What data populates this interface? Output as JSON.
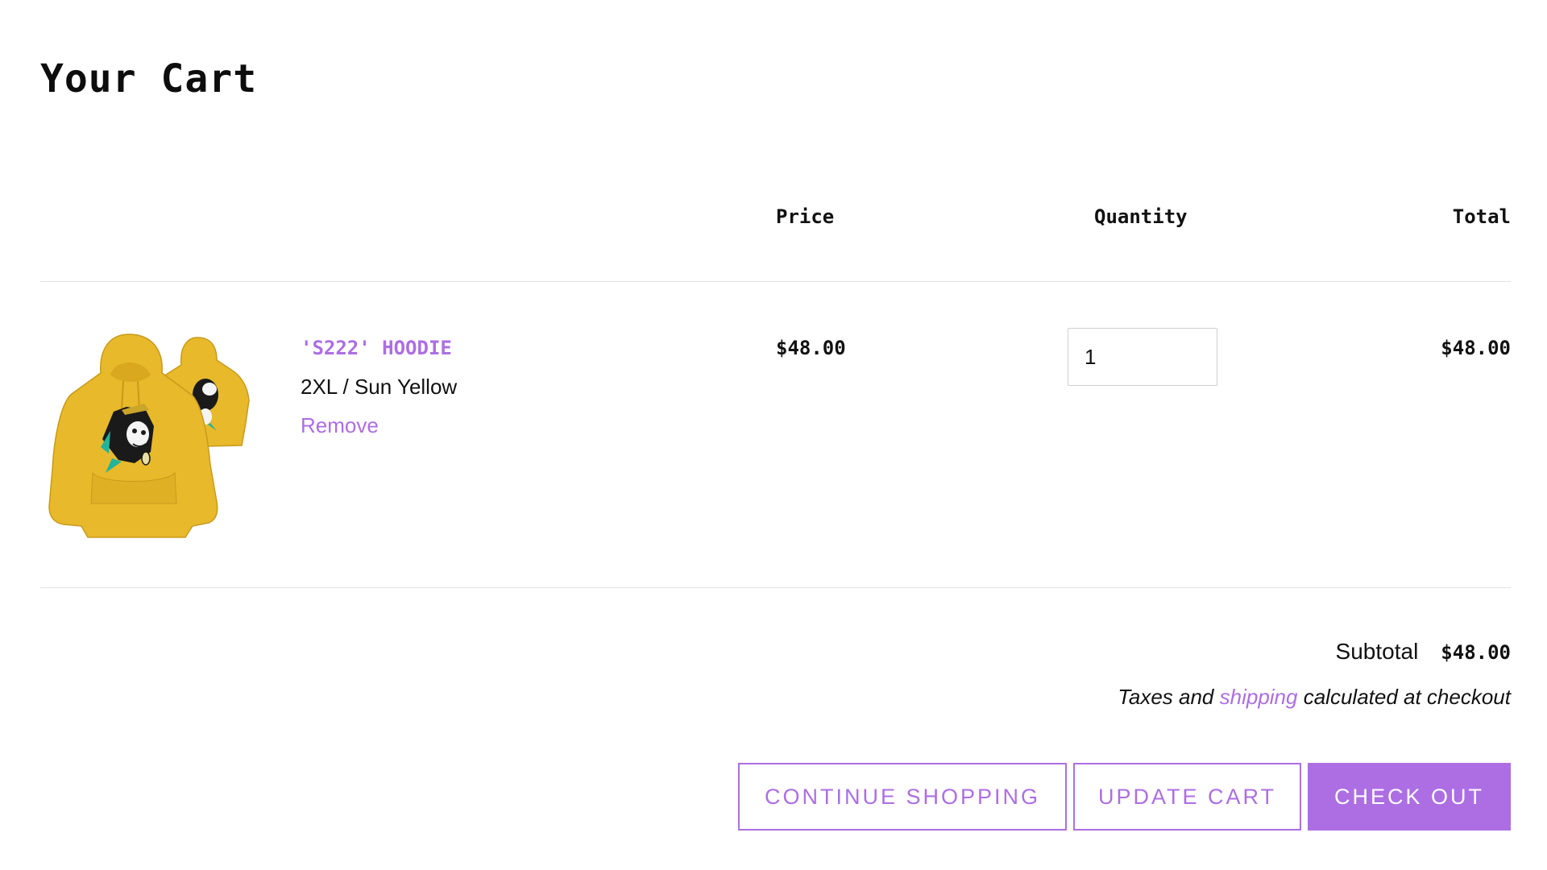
{
  "page": {
    "title": "Your Cart"
  },
  "table": {
    "headers": {
      "price": "Price",
      "quantity": "Quantity",
      "total": "Total"
    }
  },
  "cart": {
    "items": [
      {
        "title": "'S222' HOODIE",
        "variant": "2XL / Sun Yellow",
        "remove_label": "Remove",
        "price": "$48.00",
        "quantity": "1",
        "total": "$48.00",
        "image_icon": "yellow-hoodie-image"
      }
    ]
  },
  "summary": {
    "subtotal_label": "Subtotal",
    "subtotal_value": "$48.00",
    "tax_prefix": "Taxes and",
    "shipping_link": "shipping",
    "tax_suffix": "calculated at checkout"
  },
  "actions": {
    "continue_label": "CONTINUE SHOPPING",
    "update_label": "UPDATE CART",
    "checkout_label": "CHECK OUT"
  },
  "colors": {
    "accent": "#ad6ee3",
    "hoodie": "#e8b92a",
    "divider": "#e3e3e3"
  }
}
